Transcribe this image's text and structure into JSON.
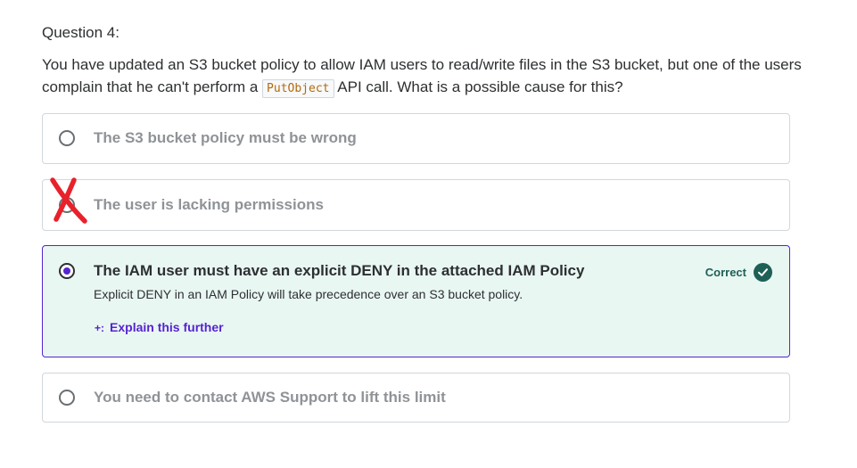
{
  "question": {
    "number_label": "Question 4:",
    "text_part1": "You have updated an S3 bucket policy to allow IAM users to read/write files in the S3 bucket, but one of the users complain that he can't perform a ",
    "code": "PutObject",
    "text_part2": " API call. What is a possible cause for this?"
  },
  "options": [
    {
      "label": "The S3 bucket policy must be wrong",
      "selected": false
    },
    {
      "label": "The user is lacking permissions",
      "selected": false,
      "marked_wrong": true
    },
    {
      "label": "The IAM user must have an explicit DENY in the attached IAM Policy",
      "selected": true,
      "status": "Correct",
      "explanation": "Explicit DENY in an IAM Policy will take precedence over an S3 bucket policy.",
      "explain_link": "Explain this further"
    },
    {
      "label": "You need to contact AWS Support to lift this limit",
      "selected": false
    }
  ],
  "icons": {
    "sparkle": "sparkle-icon",
    "check": "check-circle-icon",
    "cross": "red-x-mark"
  },
  "colors": {
    "accent": "#5624d0",
    "correct_bg": "#e9f7f3",
    "correct_text": "#1e6055",
    "wrong_mark": "#e8212b",
    "code_text": "#b4690e"
  }
}
